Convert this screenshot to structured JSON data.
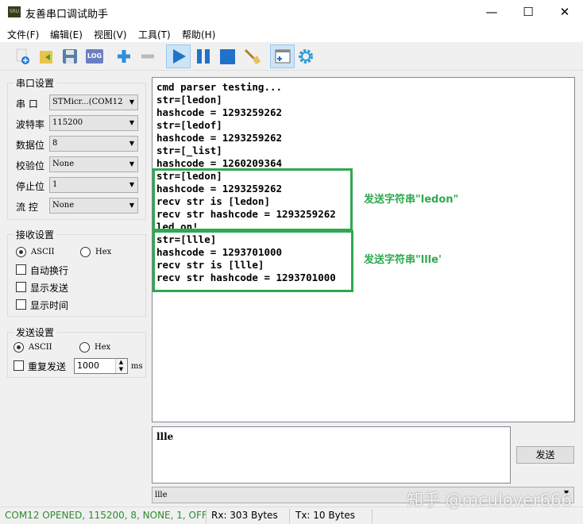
{
  "window": {
    "title": "友善串口调试助手",
    "icon": "SRU",
    "minimize": "—",
    "maximize": "☐",
    "close": "✕"
  },
  "menu": [
    "文件(F)",
    "编辑(E)",
    "视图(V)",
    "工具(T)",
    "帮助(H)"
  ],
  "toolbar": {
    "log": "LOG"
  },
  "serial": {
    "title": "串口设置",
    "port_label": "串 口",
    "port": "STMicr...(COM12",
    "baud_label": "波特率",
    "baud": "115200",
    "data_label": "数据位",
    "data": "8",
    "parity_label": "校验位",
    "parity": "None",
    "stop_label": "停止位",
    "stop": "1",
    "flow_label": "流 控",
    "flow": "None"
  },
  "receive": {
    "title": "接收设置",
    "ascii": "ASCII",
    "hex": "Hex",
    "auto_wrap": "自动换行",
    "show_send": "显示发送",
    "show_time": "显示时间"
  },
  "sendset": {
    "title": "发送设置",
    "ascii": "ASCII",
    "hex": "Hex",
    "repeat": "重复发送",
    "interval": "1000",
    "unit": "ms"
  },
  "recv_lines": [
    "cmd parser testing...",
    "str=[ledon]",
    "hashcode = 1293259262",
    "str=[ledof]",
    "hashcode = 1293259262",
    "str=[_list]",
    "hashcode = 1260209364",
    "str=[ledon]",
    "hashcode = 1293259262",
    "recv str is [ledon]",
    "recv str hashcode = 1293259262",
    "led on!",
    "str=[llle]",
    "hashcode = 1293701000",
    "recv str is [llle]",
    "recv str hashcode = 1293701000"
  ],
  "annotations": [
    "发送字符串\"ledon\"",
    "发送字符串\"llle'"
  ],
  "send_text": "llle",
  "send_button": "发送",
  "history": "llle",
  "status": {
    "conn": "COM12 OPENED, 115200, 8, NONE, 1, OFF",
    "rx": "Rx: 303 Bytes",
    "tx": "Tx: 10 Bytes"
  },
  "watermark": "知乎 @mculover666",
  "colors": {
    "accent": "#2ea84f",
    "status": "#2e8b2e"
  }
}
